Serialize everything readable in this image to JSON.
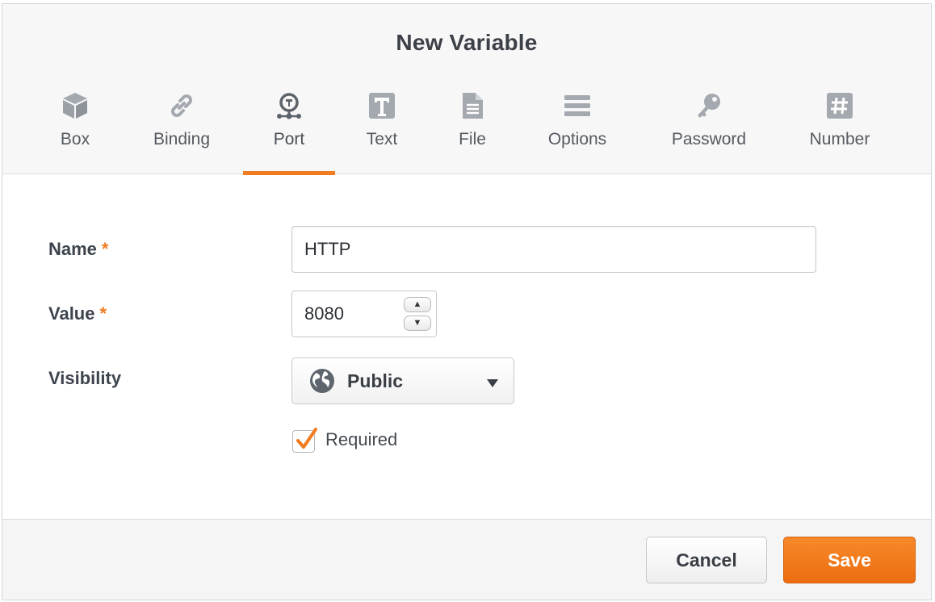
{
  "dialog": {
    "title": "New Variable"
  },
  "tabs": [
    {
      "label": "Box",
      "icon": "cube-icon",
      "active": false
    },
    {
      "label": "Binding",
      "icon": "link-icon",
      "active": false
    },
    {
      "label": "Port",
      "icon": "port-icon",
      "active": true
    },
    {
      "label": "Text",
      "icon": "text-icon",
      "active": false
    },
    {
      "label": "File",
      "icon": "file-icon",
      "active": false
    },
    {
      "label": "Options",
      "icon": "list-icon",
      "active": false
    },
    {
      "label": "Password",
      "icon": "key-icon",
      "active": false
    },
    {
      "label": "Number",
      "icon": "hash-icon",
      "active": false
    }
  ],
  "form": {
    "name": {
      "label": "Name",
      "required_mark": "*",
      "value": "HTTP"
    },
    "value": {
      "label": "Value",
      "required_mark": "*",
      "value": "8080",
      "step_up": "▲",
      "step_down": "▼"
    },
    "visibility": {
      "label": "Visibility",
      "selected": "Public",
      "icon": "globe-icon"
    },
    "required": {
      "label": "Required",
      "checked": true
    }
  },
  "footer": {
    "cancel_label": "Cancel",
    "save_label": "Save"
  },
  "colors": {
    "accent": "#f07b20",
    "icon_gray": "#9aa0a6"
  }
}
